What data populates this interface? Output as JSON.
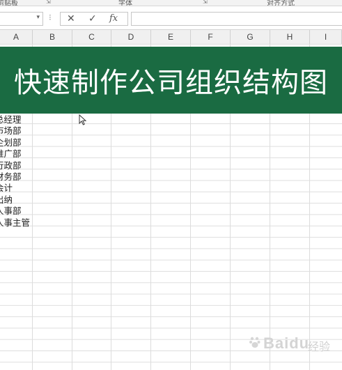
{
  "ribbon": {
    "groups": [
      "剪贴板",
      "字体",
      "对齐方式"
    ]
  },
  "formula_bar": {
    "name_box": "",
    "cancel_symbol": "✕",
    "enter_symbol": "✓",
    "fx_symbol": "fx",
    "formula_value": ""
  },
  "columns": [
    "A",
    "B",
    "C",
    "D",
    "E",
    "F",
    "G",
    "H",
    "I"
  ],
  "title_banner": "快速制作公司组织结构图",
  "column_a_cells": [
    "总经理",
    "市场部",
    "企划部",
    "推广部",
    "行政部",
    "财务部",
    "会计",
    "出纳",
    "人事部",
    "人事主管"
  ],
  "watermark": {
    "text": "Baidu",
    "sub": "经验"
  },
  "colors": {
    "banner": "#1a6b42",
    "banner_text": "#ffffff"
  }
}
